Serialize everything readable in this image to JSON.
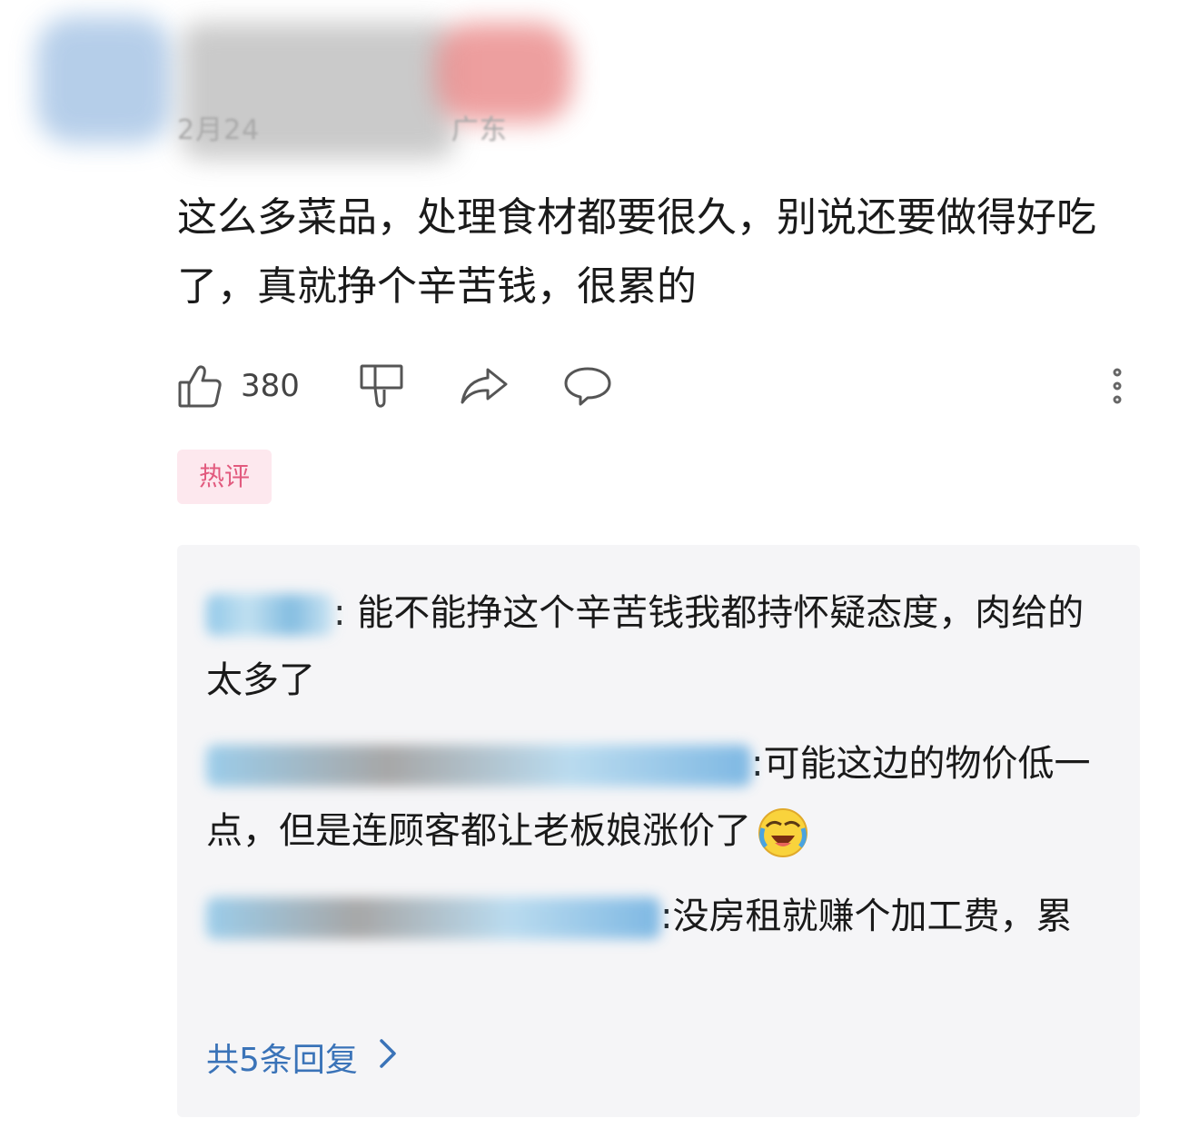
{
  "header": {
    "date": "2月24",
    "location": "广东"
  },
  "comment": {
    "text": "这么多菜品，处理食材都要很久，别说还要做得好吃了，真就挣个辛苦钱，很累的"
  },
  "actions": {
    "like_count": "380"
  },
  "hot_tag": "热评",
  "replies": [
    {
      "text": "能不能挣这个辛苦钱我都持怀疑态度，肉给的太多了"
    },
    {
      "text": "可能这边的物价低一点，但是连顾客都让老板娘涨价了",
      "emoji": "crying-laughing-emoji"
    },
    {
      "text": "没房租就赚个加工费，累"
    }
  ],
  "more_replies_label": "共5条回复",
  "icons": {
    "like": "thumbs-up-icon",
    "dislike": "thumbs-down-icon",
    "share": "share-icon",
    "reply": "comment-icon",
    "more": "more-vertical-icon"
  },
  "colors": {
    "hot_tag_text": "#e25a7e",
    "hot_tag_bg": "#fde8ee",
    "link": "#3a73b8",
    "reply_bg": "#f5f5f7"
  }
}
